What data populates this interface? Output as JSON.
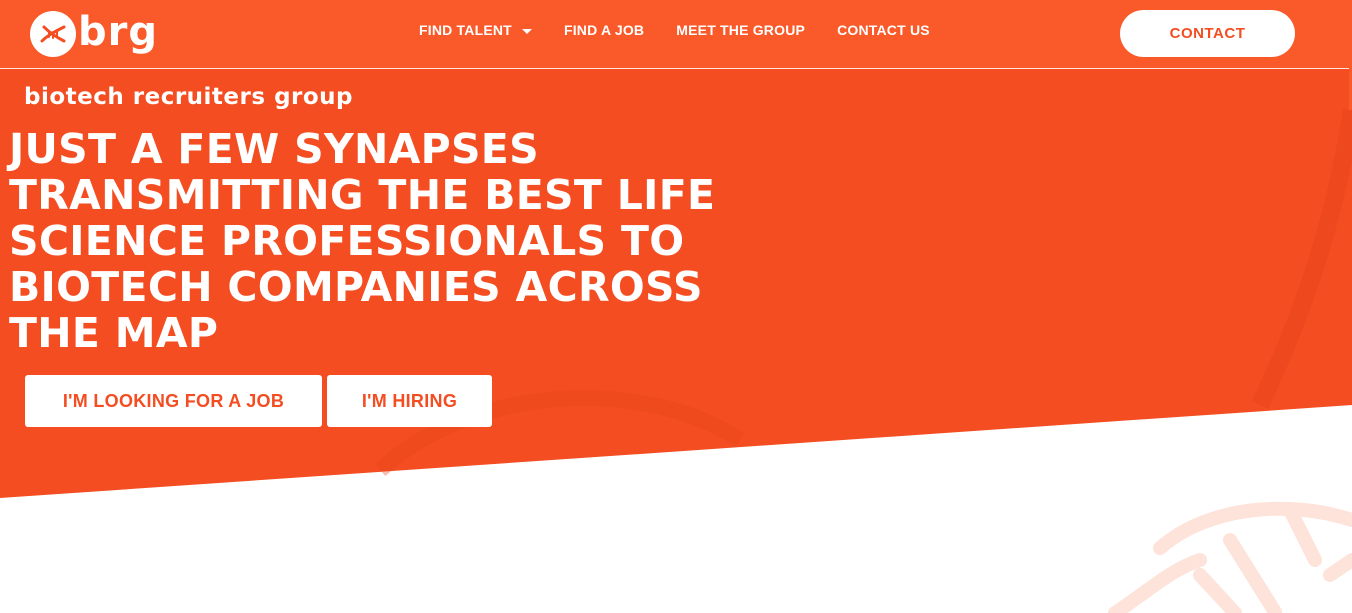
{
  "colors": {
    "brand_orange": "#f34d21",
    "header_orange": "#fa5a2a",
    "white": "#ffffff",
    "watermark": "#fde3da"
  },
  "header": {
    "logo_text": "brg",
    "logo_icon": "dna-icon",
    "nav": [
      {
        "label": "FIND TALENT",
        "has_dropdown": true,
        "icon": "chevron-down-icon"
      },
      {
        "label": "FIND A JOB"
      },
      {
        "label": "MEET THE GROUP"
      },
      {
        "label": "CONTACT US"
      }
    ],
    "contact_button": "CONTACT"
  },
  "hero": {
    "tagline": "biotech recruiters group",
    "headline": "JUST A FEW SYNAPSES TRANSMITTING THE BEST LIFE SCIENCE PROFESSIONALS TO BIOTECH COMPANIES ACROSS THE MAP",
    "buttons": {
      "job": "I'M LOOKING FOR A JOB",
      "hiring": "I'M HIRING"
    }
  }
}
